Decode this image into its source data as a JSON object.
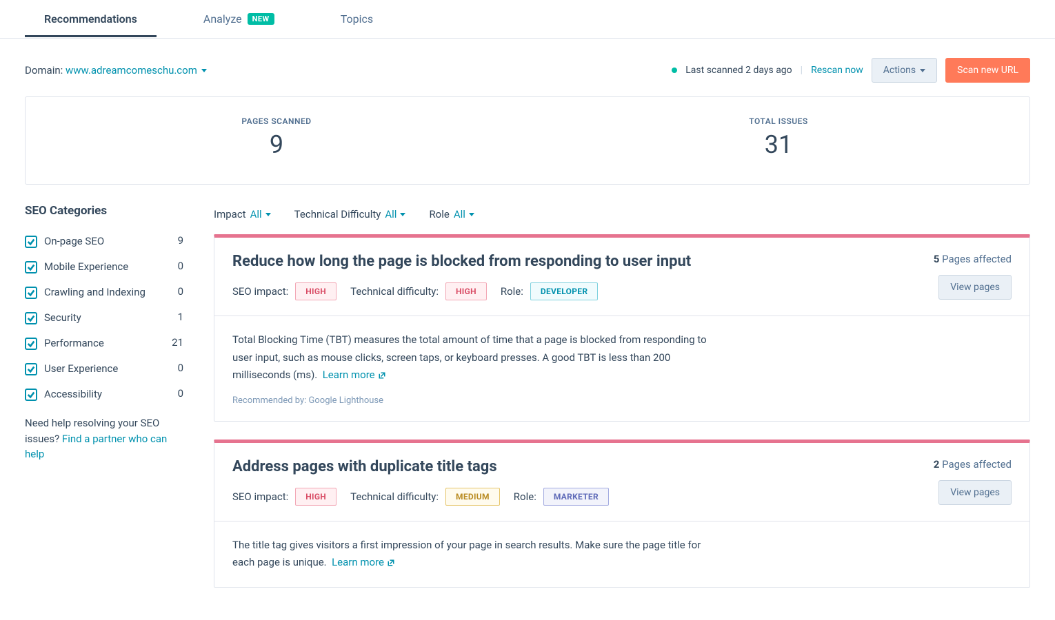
{
  "tabs": {
    "recommendations": "Recommendations",
    "analyze": "Analyze",
    "new_badge": "NEW",
    "topics": "Topics"
  },
  "domain": {
    "label": "Domain:",
    "value": "www.adreamcomeschu.com"
  },
  "status": {
    "last_scanned": "Last scanned 2 days ago",
    "rescan": "Rescan now"
  },
  "actions_btn": "Actions",
  "scan_btn": "Scan new URL",
  "summary": {
    "pages_scanned_label": "PAGES SCANNED",
    "pages_scanned_value": "9",
    "total_issues_label": "TOTAL ISSUES",
    "total_issues_value": "31"
  },
  "sidebar": {
    "heading": "SEO Categories",
    "items": [
      {
        "label": "On-page SEO",
        "count": "9"
      },
      {
        "label": "Mobile Experience",
        "count": "0"
      },
      {
        "label": "Crawling and Indexing",
        "count": "0"
      },
      {
        "label": "Security",
        "count": "1"
      },
      {
        "label": "Performance",
        "count": "21"
      },
      {
        "label": "User Experience",
        "count": "0"
      },
      {
        "label": "Accessibility",
        "count": "0"
      }
    ],
    "help_pre": "Need help resolving your SEO issues? ",
    "help_link": "Find a partner who can help"
  },
  "filters": {
    "impact_label": "Impact",
    "impact_value": "All",
    "difficulty_label": "Technical Difficulty",
    "difficulty_value": "All",
    "role_label": "Role",
    "role_value": "All"
  },
  "issues": [
    {
      "title": "Reduce how long the page is blocked from responding to user input",
      "seo_impact_label": "SEO impact:",
      "seo_impact_value": "HIGH",
      "difficulty_label": "Technical difficulty:",
      "difficulty_value": "HIGH",
      "role_label": "Role:",
      "role_value": "DEVELOPER",
      "affected_count": "5",
      "affected_text": "Pages affected",
      "view_pages": "View pages",
      "description": "Total Blocking Time (TBT) measures the total amount of time that a page is blocked from responding to user input, such as mouse clicks, screen taps, or keyboard presses. A good TBT is less than 200 milliseconds (ms).",
      "learn_more": "Learn more",
      "recommended": "Recommended by: Google Lighthouse"
    },
    {
      "title": "Address pages with duplicate title tags",
      "seo_impact_label": "SEO impact:",
      "seo_impact_value": "HIGH",
      "difficulty_label": "Technical difficulty:",
      "difficulty_value": "MEDIUM",
      "role_label": "Role:",
      "role_value": "MARKETER",
      "affected_count": "2",
      "affected_text": "Pages affected",
      "view_pages": "View pages",
      "description": "The title tag gives visitors a first impression of your page in search results. Make sure the page title for each page is unique.",
      "learn_more": "Learn more"
    }
  ]
}
